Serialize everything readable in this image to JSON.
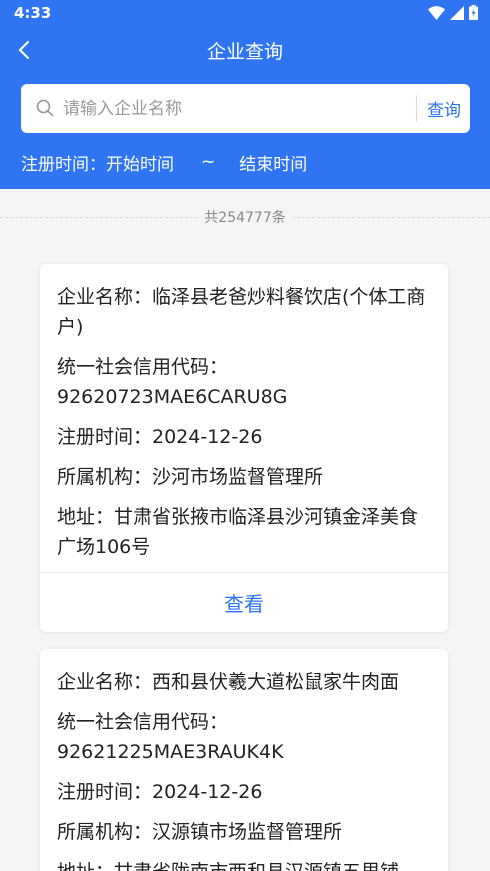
{
  "status_bar": {
    "time": "4:33"
  },
  "nav": {
    "title": "企业查询"
  },
  "search": {
    "placeholder": "请输入企业名称",
    "value": "",
    "button_label": "查询"
  },
  "date_filter": {
    "label": "注册时间：",
    "start": "开始时间",
    "separator": "~",
    "end": "结束时间"
  },
  "result_count": "共254777条",
  "cards": [
    {
      "name_line": "企业名称：临泽县老爸炒料餐饮店(个体工商户)",
      "credit_label": "统一社会信用代码：",
      "credit_code": "92620723MAE6CARU8G",
      "reg_time": "注册时间：2024-12-26",
      "agency": "所属机构：沙河市场监督管理所",
      "address": "地址：甘肃省张掖市临泽县沙河镇金泽美食广场106号",
      "view_label": "查看"
    },
    {
      "name_line": "企业名称：西和县伏羲大道松鼠家牛肉面",
      "credit_label": "统一社会信用代码：",
      "credit_code": "92621225MAE3RAUK4K",
      "reg_time": "注册时间：2024-12-26",
      "agency": "所属机构：汉源镇市场监督管理所",
      "address": "地址：甘肃省陇南市西和县汉源镇五里铺"
    }
  ]
}
